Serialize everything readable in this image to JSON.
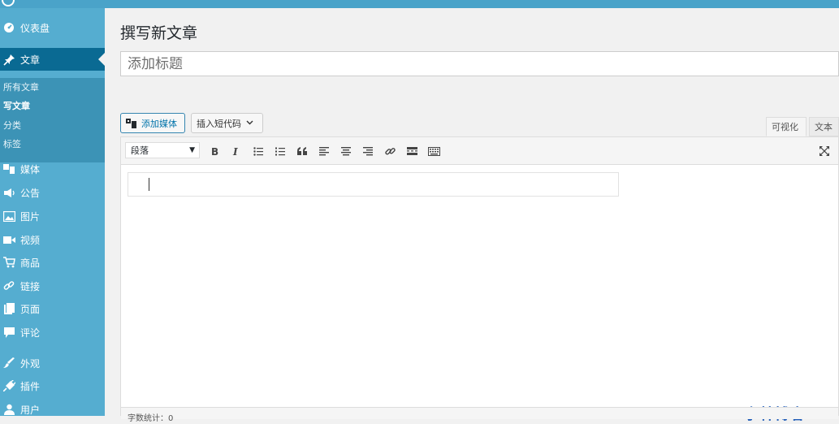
{
  "admin_bar": {
    "site": "",
    "new_label": ""
  },
  "sidebar": {
    "items": [
      {
        "label": "仪表盘",
        "icon": "dashboard-icon"
      },
      {
        "label": "文章",
        "icon": "pin-icon",
        "current": true
      },
      {
        "label": "媒体",
        "icon": "media-icon"
      },
      {
        "label": "公告",
        "icon": "megaphone-icon"
      },
      {
        "label": "图片",
        "icon": "image-icon"
      },
      {
        "label": "视频",
        "icon": "video-icon"
      },
      {
        "label": "商品",
        "icon": "cart-icon"
      },
      {
        "label": "链接",
        "icon": "link-icon"
      },
      {
        "label": "页面",
        "icon": "page-icon"
      },
      {
        "label": "评论",
        "icon": "comment-icon"
      },
      {
        "label": "外观",
        "icon": "brush-icon"
      },
      {
        "label": "插件",
        "icon": "plugin-icon"
      },
      {
        "label": "用户",
        "icon": "user-icon"
      }
    ],
    "submenu": [
      {
        "label": "所有文章"
      },
      {
        "label": "写文章",
        "active": true
      },
      {
        "label": "分类"
      },
      {
        "label": "标签"
      }
    ]
  },
  "main": {
    "page_title": "撰写新文章",
    "title_placeholder": "添加标题",
    "add_media_label": "添加媒体",
    "shortcode_label": "插入短代码",
    "tab_visual": "可视化",
    "tab_text": "文本",
    "format_value": "段落",
    "watermark": "小林博客",
    "word_count": "字数统计：0"
  },
  "toolbar_icons": [
    "bold-icon",
    "italic-icon",
    "bullet-list-icon",
    "numbered-list-icon",
    "blockquote-icon",
    "align-left-icon",
    "align-center-icon",
    "align-right-icon",
    "link-icon",
    "read-more-icon",
    "toolbar-toggle-icon",
    "fullscreen-icon"
  ]
}
